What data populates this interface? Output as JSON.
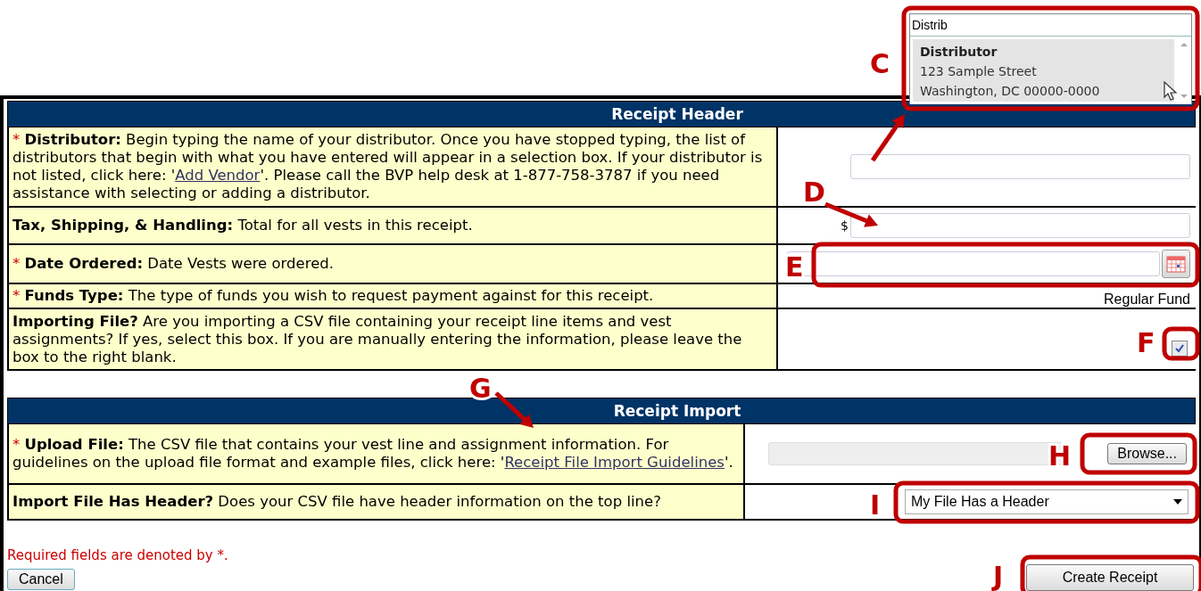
{
  "autocomplete": {
    "value": "Distrib",
    "option": {
      "name": "Distributor",
      "lines": [
        "123 Sample Street",
        "Washington, DC 00000-0000"
      ]
    }
  },
  "sections": [
    {
      "title": "Receipt Header",
      "rows": [
        {
          "required": true,
          "label": "Distributor:",
          "text": "Begin typing the name of your distributor. Once you have stopped typing, the list of distributors that begin with what you have entered will appear in a selection box. If your distributor is not listed, click here: '",
          "link": "Add Vendor",
          "text_after": "'. Please call the BVP help desk at 1-877-758-3787 if you need assistance with selecting or adding a distributor.",
          "control": {
            "kind": "text"
          }
        },
        {
          "required": false,
          "label": "Tax, Shipping, & Handling:",
          "text": "Total for all vests in this receipt.",
          "control": {
            "kind": "currency",
            "prefix": "$"
          }
        },
        {
          "required": true,
          "label": "Date Ordered:",
          "text": "Date Vests were ordered.",
          "control": {
            "kind": "date"
          }
        },
        {
          "required": true,
          "label": "Funds Type:",
          "text": "The type of funds you wish to request payment against for this receipt.",
          "control": {
            "kind": "value",
            "value": "Regular Fund"
          }
        },
        {
          "required": false,
          "label": "Importing File?",
          "text": "Are you importing a CSV file containing your receipt line items and vest assignments? If yes, select this box. If you are manually entering the information, please leave the box to the right blank.",
          "control": {
            "kind": "checkbox",
            "checked": true
          }
        }
      ]
    },
    {
      "title": "Receipt Import",
      "rows": [
        {
          "required": true,
          "label": "Upload File:",
          "text": "The CSV file that contains your vest line and assignment information. For guidelines on the upload file format and example files, click here: '",
          "link": "Receipt File Import Guidelines",
          "text_after": "'.",
          "control": {
            "kind": "file",
            "button": "Browse..."
          }
        },
        {
          "required": false,
          "label": "Import File Has Header?",
          "text": "Does your CSV file have header information on the top line?",
          "control": {
            "kind": "select",
            "value": "My File Has a Header"
          }
        }
      ]
    }
  ],
  "required_note": {
    "text": "Required fields are denoted by ",
    "mark": "*",
    "end": "."
  },
  "buttons": [
    {
      "label": "Cancel",
      "kind": "secondary"
    },
    {
      "label": "Create Receipt",
      "kind": "primary"
    }
  ],
  "callouts": [
    {
      "letter": "C"
    },
    {
      "letter": "D"
    },
    {
      "letter": "E"
    },
    {
      "letter": "F"
    },
    {
      "letter": "G"
    },
    {
      "letter": "H"
    },
    {
      "letter": "I"
    },
    {
      "letter": "J"
    }
  ]
}
